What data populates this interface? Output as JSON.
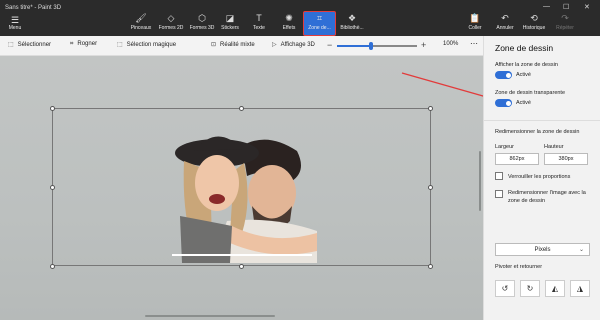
{
  "app": {
    "title": "Sans titre* - Paint 3D"
  },
  "ribbon": {
    "menu_label": "Menu",
    "tools": [
      {
        "label": "Pinceaux"
      },
      {
        "label": "Formes 2D"
      },
      {
        "label": "Formes 3D"
      },
      {
        "label": "Stickers"
      },
      {
        "label": "Texte"
      },
      {
        "label": "Effets"
      },
      {
        "label": "Zone de..."
      },
      {
        "label": "Bibliothè..."
      }
    ],
    "right_tools": [
      {
        "label": "Coller"
      },
      {
        "label": "Annuler"
      },
      {
        "label": "Historique"
      },
      {
        "label": "Répéter"
      }
    ]
  },
  "toolbar": {
    "select_label": "Sélectionner",
    "crop_label": "Rogner",
    "magic_select_label": "Sélection magique",
    "mixed_reality_label": "Réalité mixte",
    "view3d_label": "Affichage 3D",
    "zoom_value": "100%",
    "zoom_level": 0.42
  },
  "panel": {
    "title": "Zone de dessin",
    "show_canvas_label": "Afficher la zone de dessin",
    "show_canvas_state": "Activé",
    "transparent_label": "Zone de dessin transparente",
    "transparent_state": "Activé",
    "resize_label": "Redimensionner la zone de dessin",
    "width_label": "Largeur",
    "height_label": "Hauteur",
    "width_value": "862px",
    "height_value": "380px",
    "lock_label": "Verrouiller les proportions",
    "resize_image_label": "Redimensionner l'image avec la zone de dessin",
    "unit_value": "Pixels",
    "rotate_label": "Pivoter et retourner"
  },
  "colors": {
    "accent": "#2f6fd6",
    "highlight_border": "#e23b3b",
    "arrow": "#e23b3b"
  }
}
